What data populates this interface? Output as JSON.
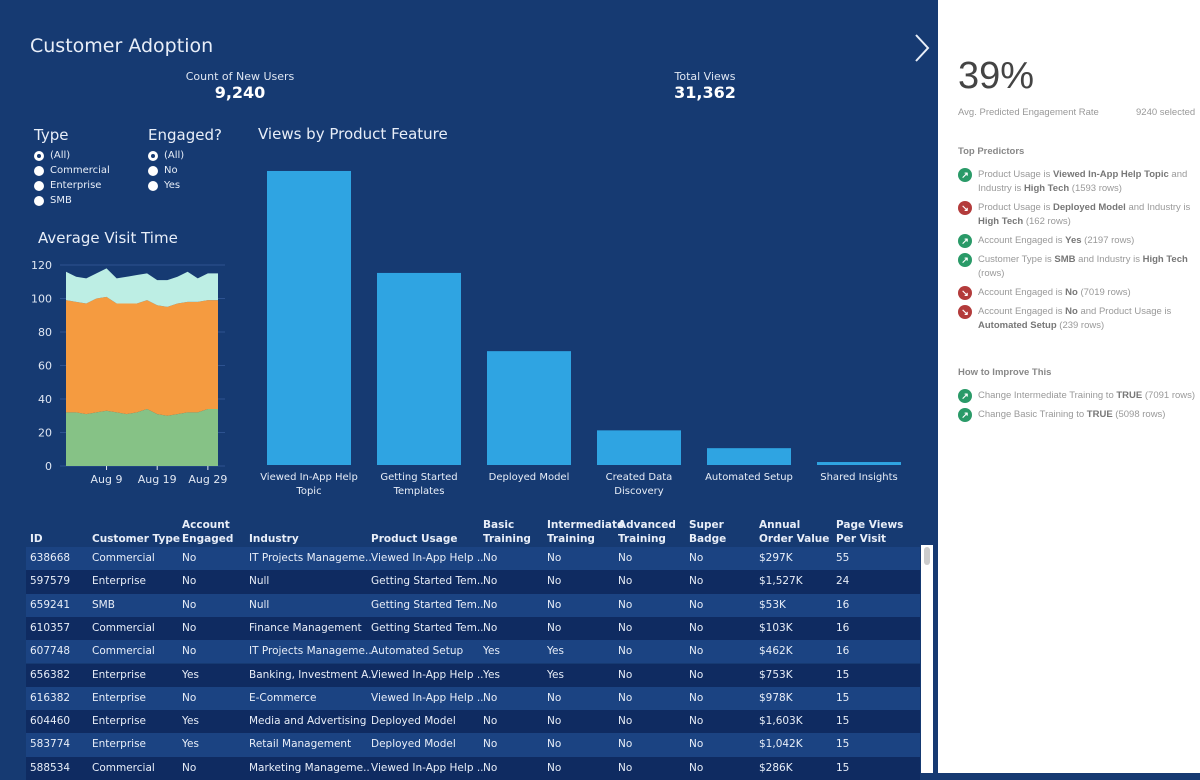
{
  "title": "Customer Adoption",
  "kpis": [
    {
      "label": "Count of New Users",
      "value": "9,240"
    },
    {
      "label": "Total Views",
      "value": "31,362"
    }
  ],
  "filters": {
    "type": {
      "title": "Type",
      "options": [
        "(All)",
        "Commercial",
        "Enterprise",
        "SMB"
      ],
      "selected": "(All)"
    },
    "engaged": {
      "title": "Engaged?",
      "options": [
        "(All)",
        "No",
        "Yes"
      ],
      "selected": "(All)"
    }
  },
  "chart_data": [
    {
      "type": "area",
      "title": "Average Visit Time",
      "stacked": true,
      "ylim": [
        0,
        120
      ],
      "yticks": [
        0,
        20,
        40,
        60,
        80,
        100,
        120
      ],
      "xticks": [
        "Aug 9",
        "Aug 19",
        "Aug 29"
      ],
      "x": [
        "Aug 1",
        "Aug 3",
        "Aug 5",
        "Aug 7",
        "Aug 9",
        "Aug 11",
        "Aug 13",
        "Aug 15",
        "Aug 17",
        "Aug 19",
        "Aug 21",
        "Aug 23",
        "Aug 25",
        "Aug 27",
        "Aug 29",
        "Aug 31"
      ],
      "colors": [
        "#86c286",
        "#f59b40",
        "#bdeee4"
      ],
      "series": [
        {
          "values": [
            32,
            32,
            31,
            32,
            33,
            32,
            31,
            32,
            34,
            31,
            30,
            31,
            32,
            32,
            34,
            34
          ]
        },
        {
          "values": [
            67,
            66,
            66,
            68,
            68,
            65,
            66,
            65,
            65,
            65,
            65,
            66,
            66,
            66,
            65,
            65
          ]
        },
        {
          "values": [
            17,
            15,
            15,
            15,
            17,
            15,
            16,
            17,
            16,
            15,
            16,
            16,
            18,
            14,
            16,
            16
          ]
        }
      ]
    },
    {
      "type": "bar",
      "title": "Views by Product Feature",
      "color": "#2fa4e2",
      "categories": [
        "Viewed In-App Help Topic",
        "Getting Started Templates",
        "Deployed Model",
        "Created Data Discovery",
        "Automated Setup",
        "Shared Insights"
      ],
      "values": [
        297,
        194,
        115,
        35,
        17,
        3
      ]
    }
  ],
  "table": {
    "columns": [
      "ID",
      "Customer Type",
      "Account Engaged",
      "Industry",
      "Product Usage",
      "Basic Training",
      "Intermediate Training",
      "Advanced Training",
      "Super Badge",
      "Annual Order Value",
      "Page Views Per Visit"
    ],
    "rows": [
      [
        "638668",
        "Commercial",
        "No",
        "IT Projects Manageme..",
        "Viewed In-App Help ..",
        "No",
        "No",
        "No",
        "No",
        "$297K",
        "55"
      ],
      [
        "597579",
        "Enterprise",
        "No",
        "Null",
        "Getting Started Tem..",
        "No",
        "No",
        "No",
        "No",
        "$1,527K",
        "24"
      ],
      [
        "659241",
        "SMB",
        "No",
        "Null",
        "Getting Started Tem..",
        "No",
        "No",
        "No",
        "No",
        "$53K",
        "16"
      ],
      [
        "610357",
        "Commercial",
        "No",
        "Finance Management",
        "Getting Started Tem..",
        "No",
        "No",
        "No",
        "No",
        "$103K",
        "16"
      ],
      [
        "607748",
        "Commercial",
        "No",
        "IT Projects Manageme..",
        "Automated Setup",
        "Yes",
        "Yes",
        "No",
        "No",
        "$462K",
        "16"
      ],
      [
        "656382",
        "Enterprise",
        "Yes",
        "Banking, Investment A..",
        "Viewed In-App Help ..",
        "Yes",
        "Yes",
        "No",
        "No",
        "$753K",
        "15"
      ],
      [
        "616382",
        "Enterprise",
        "No",
        "E-Commerce",
        "Viewed In-App Help ..",
        "No",
        "No",
        "No",
        "No",
        "$978K",
        "15"
      ],
      [
        "604460",
        "Enterprise",
        "Yes",
        "Media and Advertising",
        "Deployed Model",
        "No",
        "No",
        "No",
        "No",
        "$1,603K",
        "15"
      ],
      [
        "583774",
        "Enterprise",
        "Yes",
        "Retail Management",
        "Deployed Model",
        "No",
        "No",
        "No",
        "No",
        "$1,042K",
        "15"
      ],
      [
        "588534",
        "Commercial",
        "No",
        "Marketing Manageme..",
        "Viewed In-App Help ..",
        "No",
        "No",
        "No",
        "No",
        "$286K",
        "15"
      ]
    ]
  },
  "panel": {
    "rate": "39%",
    "rate_label": "Avg. Predicted Engagement Rate",
    "selected": "9240 selected",
    "predictors_title": "Top Predictors",
    "predictors": [
      {
        "dir": "up",
        "html": "Product Usage is <b>Viewed In-App Help Topic</b> and Industry is <b>High Tech</b> (1593 rows)"
      },
      {
        "dir": "down",
        "html": "Product Usage is <b>Deployed Model</b> and Industry is <b>High Tech</b> (162 rows)"
      },
      {
        "dir": "up",
        "html": "Account Engaged is <b>Yes</b> (2197 rows)"
      },
      {
        "dir": "up",
        "html": "Customer Type is <b>SMB</b> and Industry is <b>High Tech</b> (rows)"
      },
      {
        "dir": "down",
        "html": "Account Engaged is <b>No</b> (7019 rows)"
      },
      {
        "dir": "down",
        "html": "Account Engaged is <b>No</b> and Product Usage is <b>Automated Setup</b> (239 rows)"
      }
    ],
    "improve_title": "How to Improve This",
    "improve": [
      {
        "dir": "up",
        "html": "Change Intermediate Training to <b>TRUE</b> (7091 rows)"
      },
      {
        "dir": "up",
        "html": "Change Basic Training to <b>TRUE</b> (5098 rows)"
      }
    ]
  }
}
